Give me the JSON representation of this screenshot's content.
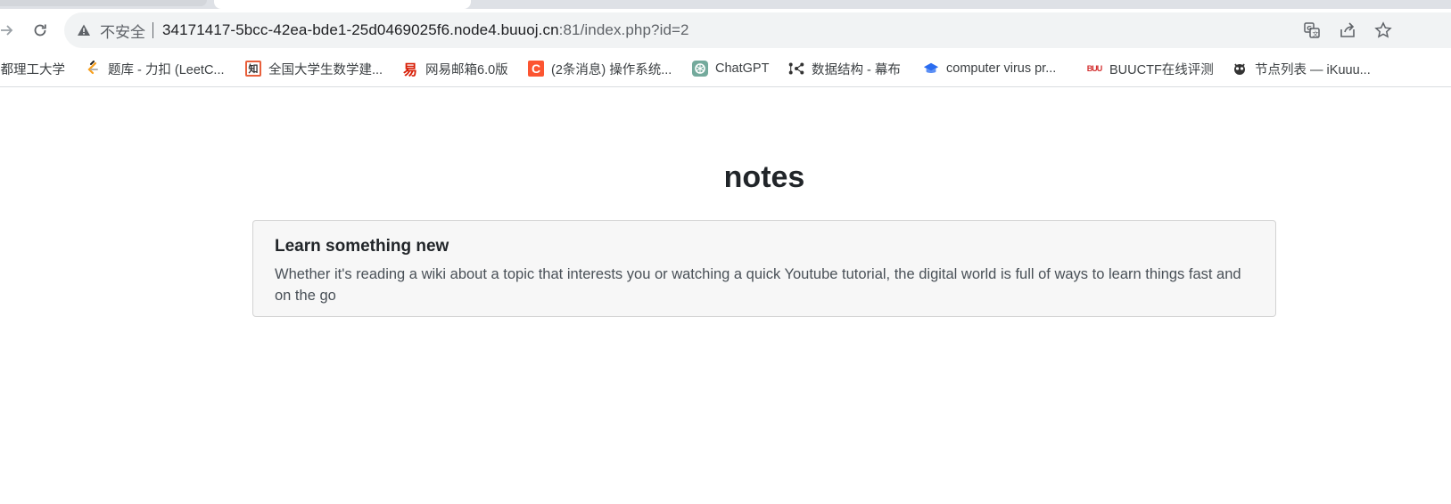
{
  "browser": {
    "address_bar": {
      "security_label": "不安全",
      "url_host": "34171417-5bcc-42ea-bde1-25d0469025f6.node4.buuoj.cn",
      "url_path": ":81/index.php?id=2"
    },
    "bookmarks": [
      {
        "label": "成都理工大学",
        "icon": "university-icon",
        "color": "#1a5fb4"
      },
      {
        "label": "题库 - 力扣 (LeetC...",
        "icon": "leetcode-icon",
        "color": "#f89f1b"
      },
      {
        "label": "全国大学生数学建...",
        "icon": "zhi-icon",
        "color": "#e8603c"
      },
      {
        "label": "网易邮箱6.0版",
        "icon": "netease-mail-icon",
        "color": "#d81e06"
      },
      {
        "label": "(2条消息) 操作系统...",
        "icon": "csdn-icon",
        "color": "#fc5531"
      },
      {
        "label": "ChatGPT",
        "icon": "chatgpt-icon",
        "color": "#10a37f"
      },
      {
        "label": "数据结构 - 幕布",
        "icon": "mubu-icon",
        "color": "#333333"
      },
      {
        "label": "computer virus pr...",
        "icon": "virus-bookmark-icon",
        "color": "#2a6cf0"
      },
      {
        "label": "BUUCTF在线评测",
        "icon": "buuctf-icon",
        "color": "#d32f2f"
      },
      {
        "label": "节点列表 — iKuuu...",
        "icon": "ikuuu-icon",
        "color": "#333333"
      }
    ]
  },
  "page": {
    "title": "notes",
    "card": {
      "title": "Learn something new",
      "text": "Whether it's reading a wiki about a topic that interests you or watching a quick Youtube tutorial, the digital world is full of ways to learn things fast and on the go"
    }
  }
}
